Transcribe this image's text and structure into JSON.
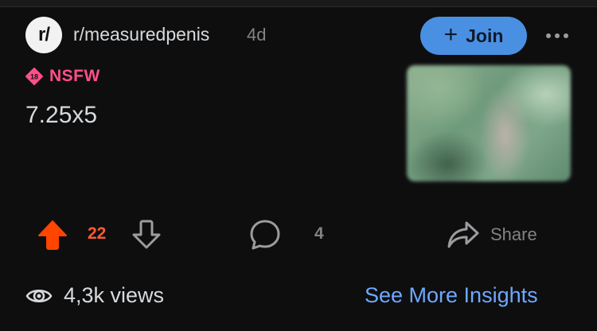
{
  "post": {
    "subreddit_icon_text": "r/",
    "subreddit": "r/measuredpenis",
    "age": "4d",
    "join_label": "Join",
    "nsfw_label": "NSFW",
    "nsfw_badge_text": "18",
    "title": "7.25x5"
  },
  "actions": {
    "score": "22",
    "comments": "4",
    "share_label": "Share"
  },
  "footer": {
    "views": "4,3k views",
    "insights_label": "See More Insights"
  },
  "colors": {
    "accent": "#4a90e2",
    "upvote": "#ff4500",
    "nsfw": "#ff4f8b",
    "link": "#6ea8ff"
  },
  "icons": [
    "more-icon",
    "plus-icon",
    "nsfw-icon",
    "upvote-icon",
    "downvote-icon",
    "comment-icon",
    "share-icon",
    "eye-icon"
  ]
}
